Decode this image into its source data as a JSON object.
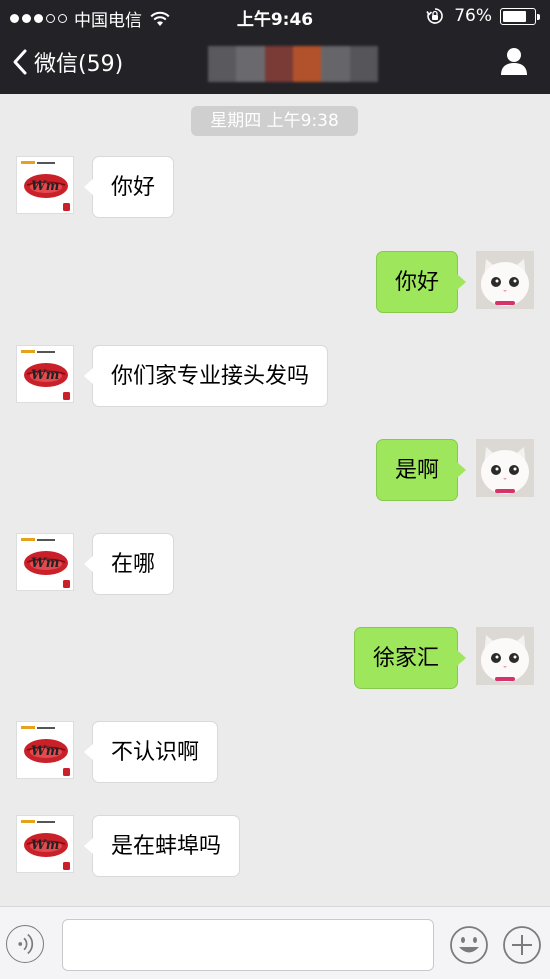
{
  "status_bar": {
    "carrier": "中国电信",
    "time": "上午9:46",
    "battery_percent": "76%",
    "battery_level": 0.76,
    "icons": [
      "signal-dots",
      "wifi-icon",
      "rotation-lock-icon",
      "battery-icon"
    ]
  },
  "nav": {
    "back_label": "微信(59)",
    "title_colors": [
      "#5a5a5e",
      "#6a6a6e",
      "#7a3a36",
      "#b2522c",
      "#66666a",
      "#55555a"
    ],
    "icons": [
      "back-chevron-icon",
      "person-icon"
    ]
  },
  "chat": {
    "timestamp": "星期四 上午9:38",
    "messages": [
      {
        "side": "in",
        "text": "你好"
      },
      {
        "side": "out",
        "text": "你好"
      },
      {
        "side": "in",
        "text": "你们家专业接头发吗"
      },
      {
        "side": "out",
        "text": "是啊"
      },
      {
        "side": "in",
        "text": "在哪"
      },
      {
        "side": "out",
        "text": "徐家汇"
      },
      {
        "side": "in",
        "text": "不认识啊"
      },
      {
        "side": "in",
        "text": "是在蚌埠吗"
      }
    ]
  },
  "input_bar": {
    "text_value": "",
    "icons": [
      "voice-icon",
      "emoji-icon",
      "plus-icon"
    ]
  },
  "colors": {
    "nav_bg": "#232327",
    "chat_bg": "#ebebeb",
    "out_bubble": "#9ee75c",
    "in_bubble": "#ffffff"
  }
}
